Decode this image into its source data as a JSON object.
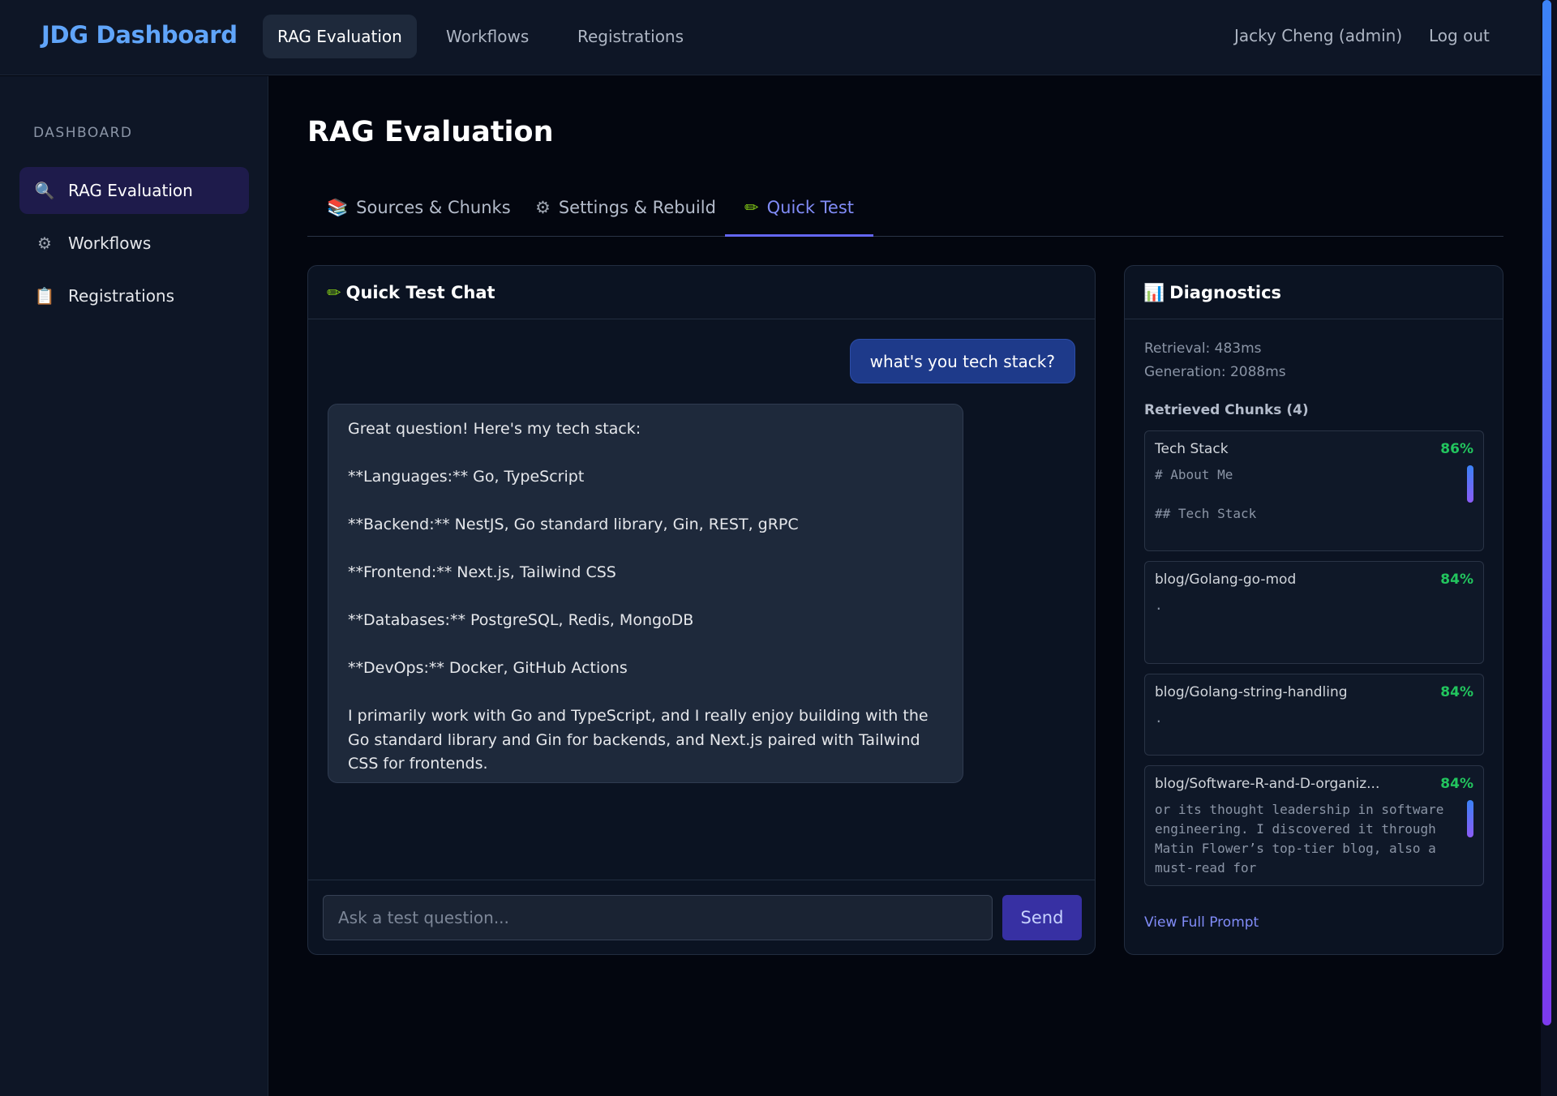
{
  "topnav": {
    "brand": "JDG Dashboard",
    "tabs": [
      {
        "label": "RAG Evaluation"
      },
      {
        "label": "Workflows"
      },
      {
        "label": "Registrations"
      }
    ],
    "user": "Jacky Cheng (admin)",
    "logout": "Log out"
  },
  "sidebar": {
    "heading": "DASHBOARD",
    "items": [
      {
        "label": "RAG Evaluation",
        "icon": "magnifier-icon"
      },
      {
        "label": "Workflows",
        "icon": "gear-icon"
      },
      {
        "label": "Registrations",
        "icon": "clipboard-icon"
      }
    ]
  },
  "main": {
    "title": "RAG Evaluation",
    "tabs": [
      {
        "label": "Sources & Chunks",
        "icon": "books-icon"
      },
      {
        "label": "Settings & Rebuild",
        "icon": "gear-icon"
      },
      {
        "label": "Quick Test",
        "icon": "pencil-icon"
      }
    ]
  },
  "chat": {
    "title": "Quick Test Chat",
    "user_message": "what's you tech stack?",
    "bot_paragraphs": [
      "Great question! Here's my tech stack:",
      "**Languages:** Go, TypeScript",
      "**Backend:** NestJS, Go standard library, Gin, REST, gRPC",
      "**Frontend:** Next.js, Tailwind CSS",
      "**Databases:** PostgreSQL, Redis, MongoDB",
      "**DevOps:** Docker, GitHub Actions",
      "I primarily work with Go and TypeScript, and I really enjoy building with the Go standard library and Gin for backends, and Next.js paired with Tailwind CSS for frontends."
    ],
    "input_placeholder": "Ask a test question...",
    "send_label": "Send"
  },
  "diagnostics": {
    "title": "Diagnostics",
    "retrieval": "Retrieval: 483ms",
    "generation": "Generation: 2088ms",
    "chunks_title": "Retrieved Chunks (4)",
    "chunks": [
      {
        "name": "Tech Stack",
        "score": "86%",
        "text": "# About Me\n\n## Tech Stack"
      },
      {
        "name": "blog/Golang-go-mod",
        "score": "84%",
        "text": "."
      },
      {
        "name": "blog/Golang-string-handling",
        "score": "84%",
        "text": "."
      },
      {
        "name": "blog/Software-R-and-D-organiz...",
        "score": "84%",
        "text": "or its thought leadership in software engineering. I discovered it through Matin Flower’s top-tier blog, also a must-read for"
      }
    ],
    "view_prompt": "View Full Prompt"
  },
  "colors": {
    "accent": "#6366f1",
    "brand": "#60a5fa",
    "score_green": "#22c55e",
    "user_bubble": "#1e3a8a"
  }
}
